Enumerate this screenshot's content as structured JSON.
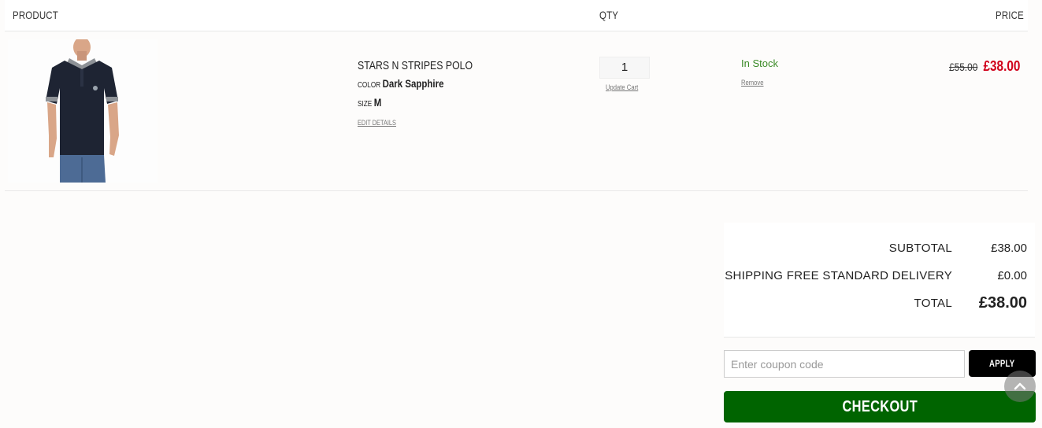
{
  "table_header": {
    "product": "PRODUCT",
    "qty": "QTY",
    "price": "PRICE"
  },
  "cart_item": {
    "image_icon": "polo-shirt-model-image",
    "name": "STARS N STRIPES POLO",
    "color_label": "COLOR",
    "color_value": "Dark Sapphire",
    "size_label": "SIZE",
    "size_value": "M",
    "edit_details": "EDIT DETAILS",
    "quantity": "1",
    "update_cart": "Update Cart",
    "stock_status": "In Stock",
    "remove": "Remove",
    "old_price": "£55.00",
    "new_price": "£38.00"
  },
  "summary": {
    "subtotal_label": "SUBTOTAL",
    "subtotal_value": "£38.00",
    "shipping_label": "SHIPPING FREE STANDARD DELIVERY",
    "shipping_value": "£0.00",
    "total_label": "TOTAL",
    "total_value": "£38.00"
  },
  "coupon": {
    "placeholder": "Enter coupon code",
    "apply_label": "APPLY"
  },
  "checkout_label": "CHECKOUT",
  "scroll_top_icon": "chevron-up-icon",
  "colors": {
    "sale_price": "#d0021b",
    "in_stock": "#3a8a26",
    "checkout_bg": "#006400",
    "apply_bg": "#000000"
  }
}
